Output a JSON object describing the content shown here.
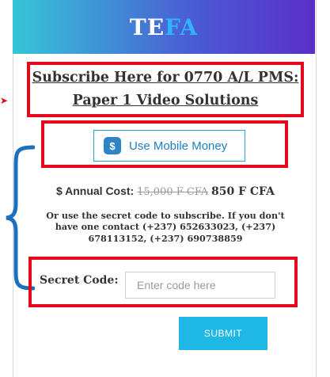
{
  "brand": {
    "logo_part1": "TE",
    "logo_part2": "FA"
  },
  "title": "Subscribe Here for 0770 A/L PMS: Paper 1 Video Solutions",
  "payment": {
    "button_label": "Use Mobile Money",
    "icon": "mobile-money-icon",
    "icon_glyph": "$"
  },
  "cost": {
    "label": "$ Annual Cost:",
    "old_price": "15,000 F CFA",
    "new_price": "850 F CFA"
  },
  "note": "Or use the secret code to subscribe. If you don't have one contact (+237) 652633023, (+237) 678113152, (+237) 690738859",
  "secret_code": {
    "label": "Secret Code:",
    "placeholder": "Enter code here",
    "value": ""
  },
  "submit_label": "SUBMIT",
  "colors": {
    "annotation_red": "#e3091b",
    "brace_blue": "#1f6fbf",
    "submit_blue": "#1fb8e6"
  }
}
